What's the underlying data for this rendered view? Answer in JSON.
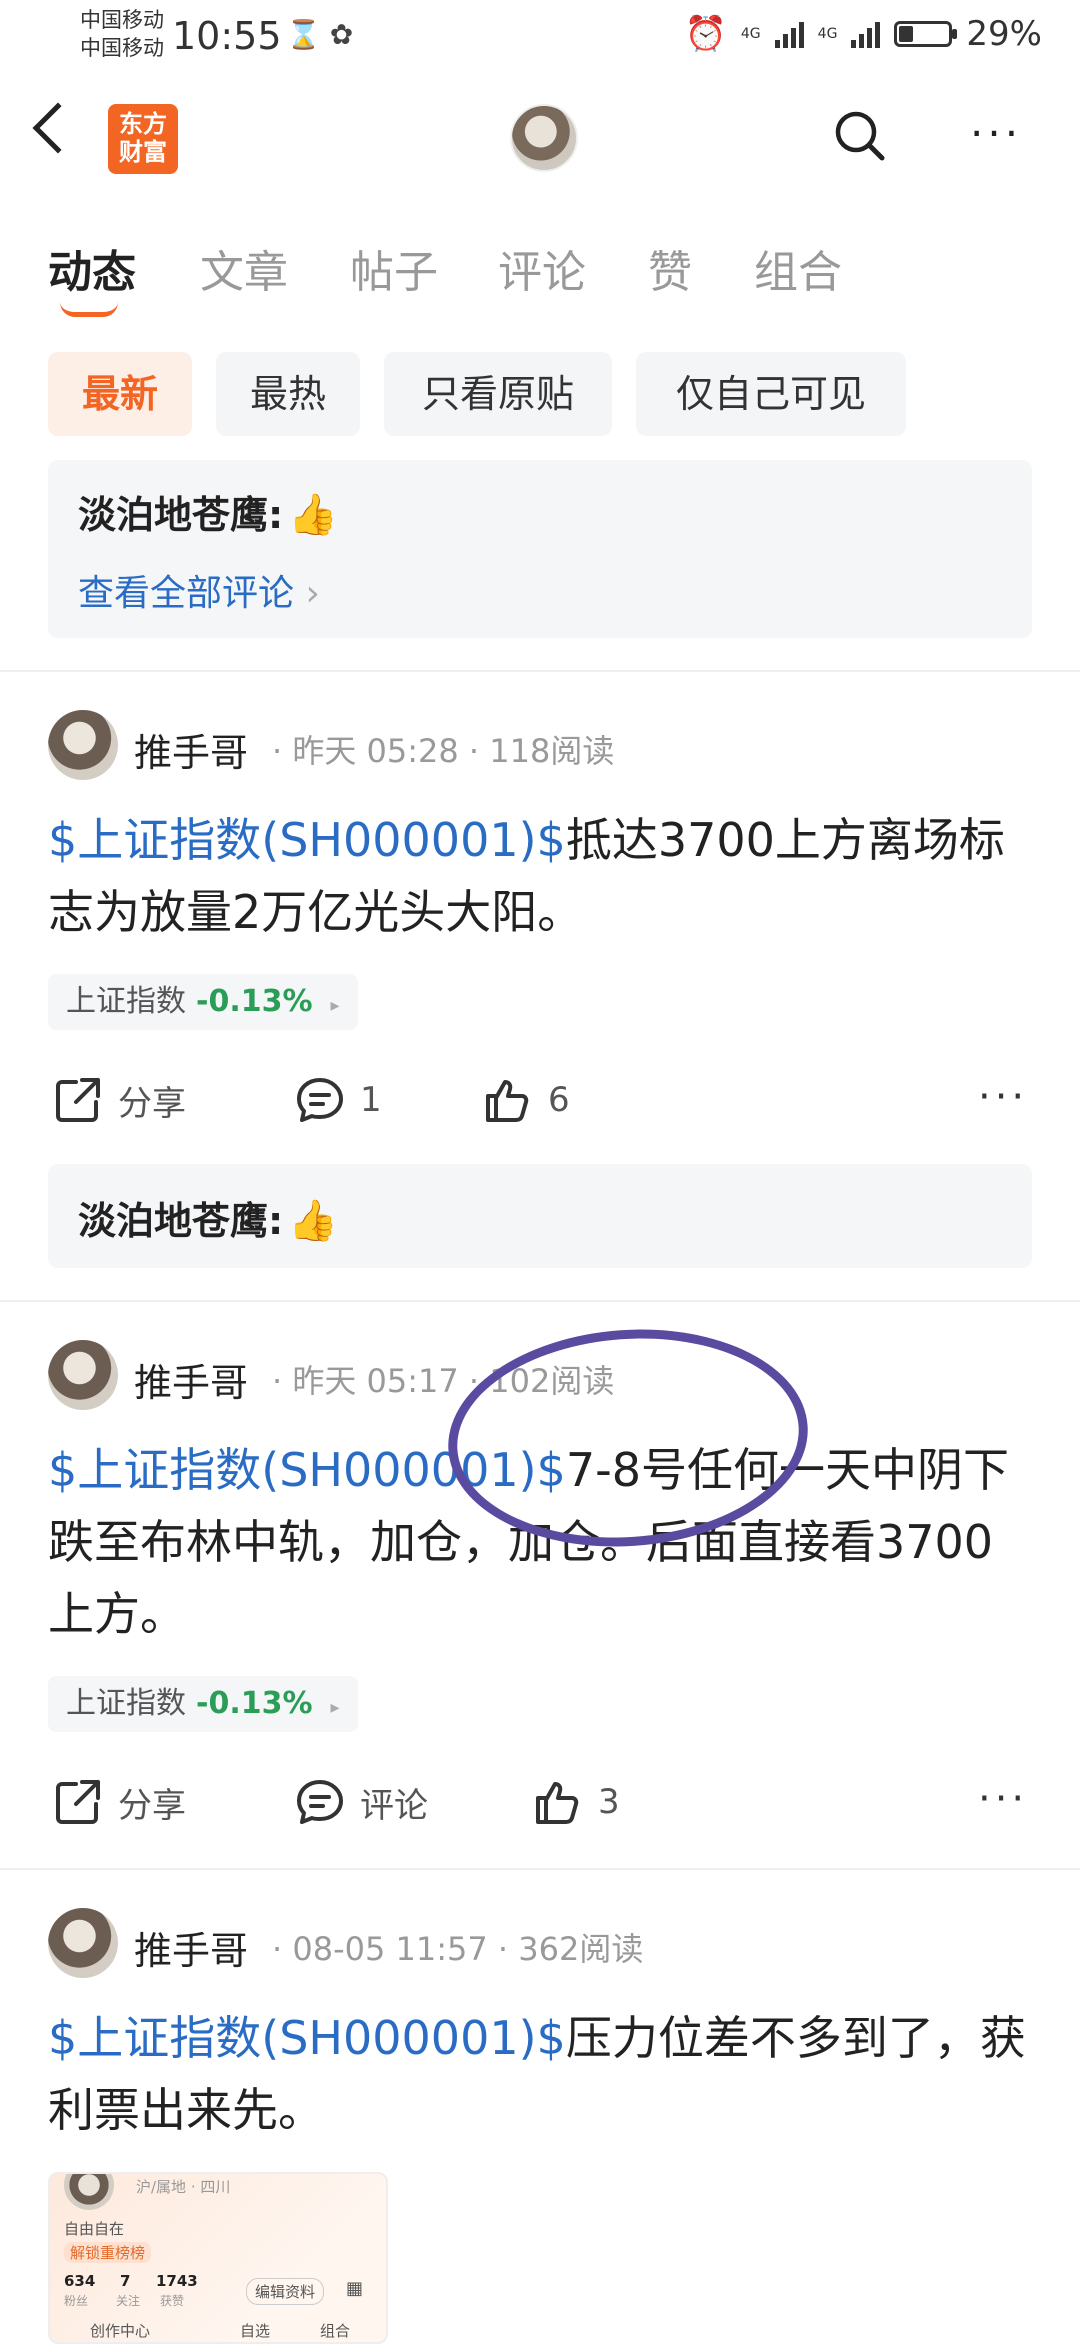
{
  "status": {
    "carrier1": "中国移动",
    "carrier2": "中国移动",
    "time": "10:55",
    "net1": "4G",
    "net2": "4G",
    "battery": "29%",
    "battery_fraction": 0.29
  },
  "header": {
    "logo_line1": "东方",
    "logo_line2": "财富"
  },
  "tabs": [
    "动态",
    "文章",
    "帖子",
    "评论",
    "赞",
    "组合"
  ],
  "filters": [
    "最新",
    "最热",
    "只看原贴",
    "仅自己可见"
  ],
  "top_comment": {
    "name": "淡泊地苍鹰:",
    "thumb": "👍",
    "view_all": "查看全部评论",
    "chevron": "›"
  },
  "posts": [
    {
      "author": "推手哥",
      "sep": "·",
      "date": "昨天 05:28",
      "reads": "118阅读",
      "stock": "$上证指数(SH000001)$",
      "text": "抵达3700上方离场标志为放量2万亿光头大阳。",
      "tag_name": "上证指数",
      "tag_pct": "-0.13%",
      "tag_arrow": "▸",
      "share": "分享",
      "comment": "1",
      "like": "6",
      "more": "···",
      "reply": {
        "name": "淡泊地苍鹰:",
        "thumb": "👍"
      }
    },
    {
      "author": "推手哥",
      "sep": "·",
      "date": "昨天 05:17",
      "reads": "102阅读",
      "stock": "$上证指数(SH000001)$",
      "text": "7-8号任何一天中阴下跌至布林中轨，加仓，加仓。后面直接看3700上方。",
      "tag_name": "上证指数",
      "tag_pct": "-0.13%",
      "tag_arrow": "▸",
      "share": "分享",
      "comment": "评论",
      "like": "3",
      "more": "···"
    },
    {
      "author": "推手哥",
      "sep": "·",
      "date": "08-05 11:57",
      "reads": "362阅读",
      "stock": "$上证指数(SH000001)$",
      "text": "压力位差不多到了，获利票出来先。"
    }
  ],
  "thumbnail": {
    "location": "沪/属地 · 四川",
    "bio": "自由自在",
    "badge": "解锁重榜榜",
    "fans": "634",
    "fans_label": "粉丝",
    "follow": "7",
    "follow_label": "关注",
    "likes": "1743",
    "likes_label": "获赞",
    "edit": "编辑资料",
    "creator": "创作中心",
    "watch": "自选",
    "combo": "组合"
  }
}
